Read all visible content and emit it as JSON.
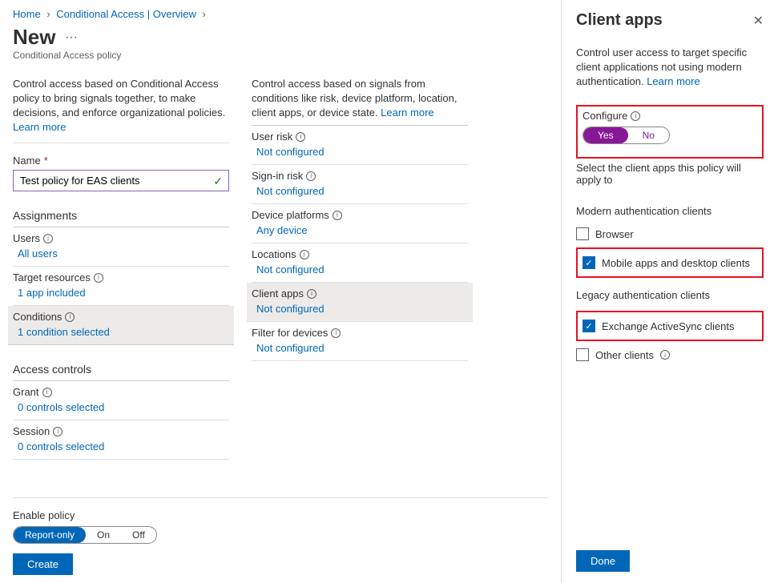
{
  "breadcrumb": {
    "home": "Home",
    "ca": "Conditional Access | Overview"
  },
  "page": {
    "title": "New",
    "subtitle": "Conditional Access policy"
  },
  "intro_left": "Control access based on Conditional Access policy to bring signals together, to make decisions, and enforce organizational policies.",
  "learn_more": "Learn more",
  "name_label": "Name",
  "name_value": "Test policy for EAS clients",
  "assignments_header": "Assignments",
  "users": {
    "label": "Users",
    "value": "All users"
  },
  "target": {
    "label": "Target resources",
    "value": "1 app included"
  },
  "conditions": {
    "label": "Conditions",
    "value": "1 condition selected"
  },
  "access_header": "Access controls",
  "grant": {
    "label": "Grant",
    "value": "0 controls selected"
  },
  "session": {
    "label": "Session",
    "value": "0 controls selected"
  },
  "intro_right": "Control access based on signals from conditions like risk, device platform, location, client apps, or device state.",
  "cond": {
    "user_risk": {
      "label": "User risk",
      "value": "Not configured"
    },
    "signin_risk": {
      "label": "Sign-in risk",
      "value": "Not configured"
    },
    "device_platforms": {
      "label": "Device platforms",
      "value": "Any device"
    },
    "locations": {
      "label": "Locations",
      "value": "Not configured"
    },
    "client_apps": {
      "label": "Client apps",
      "value": "Not configured"
    },
    "filter": {
      "label": "Filter for devices",
      "value": "Not configured"
    }
  },
  "enable_label": "Enable policy",
  "tri": {
    "report": "Report-only",
    "on": "On",
    "off": "Off"
  },
  "create_btn": "Create",
  "panel": {
    "title": "Client apps",
    "desc": "Control user access to target specific client applications not using modern authentication.",
    "configure": "Configure",
    "yes": "Yes",
    "no": "No",
    "select_text": "Select the client apps this policy will apply to",
    "modern": "Modern authentication clients",
    "browser": "Browser",
    "mobile": "Mobile apps and desktop clients",
    "legacy": "Legacy authentication clients",
    "eas": "Exchange ActiveSync clients",
    "other": "Other clients",
    "done": "Done"
  }
}
